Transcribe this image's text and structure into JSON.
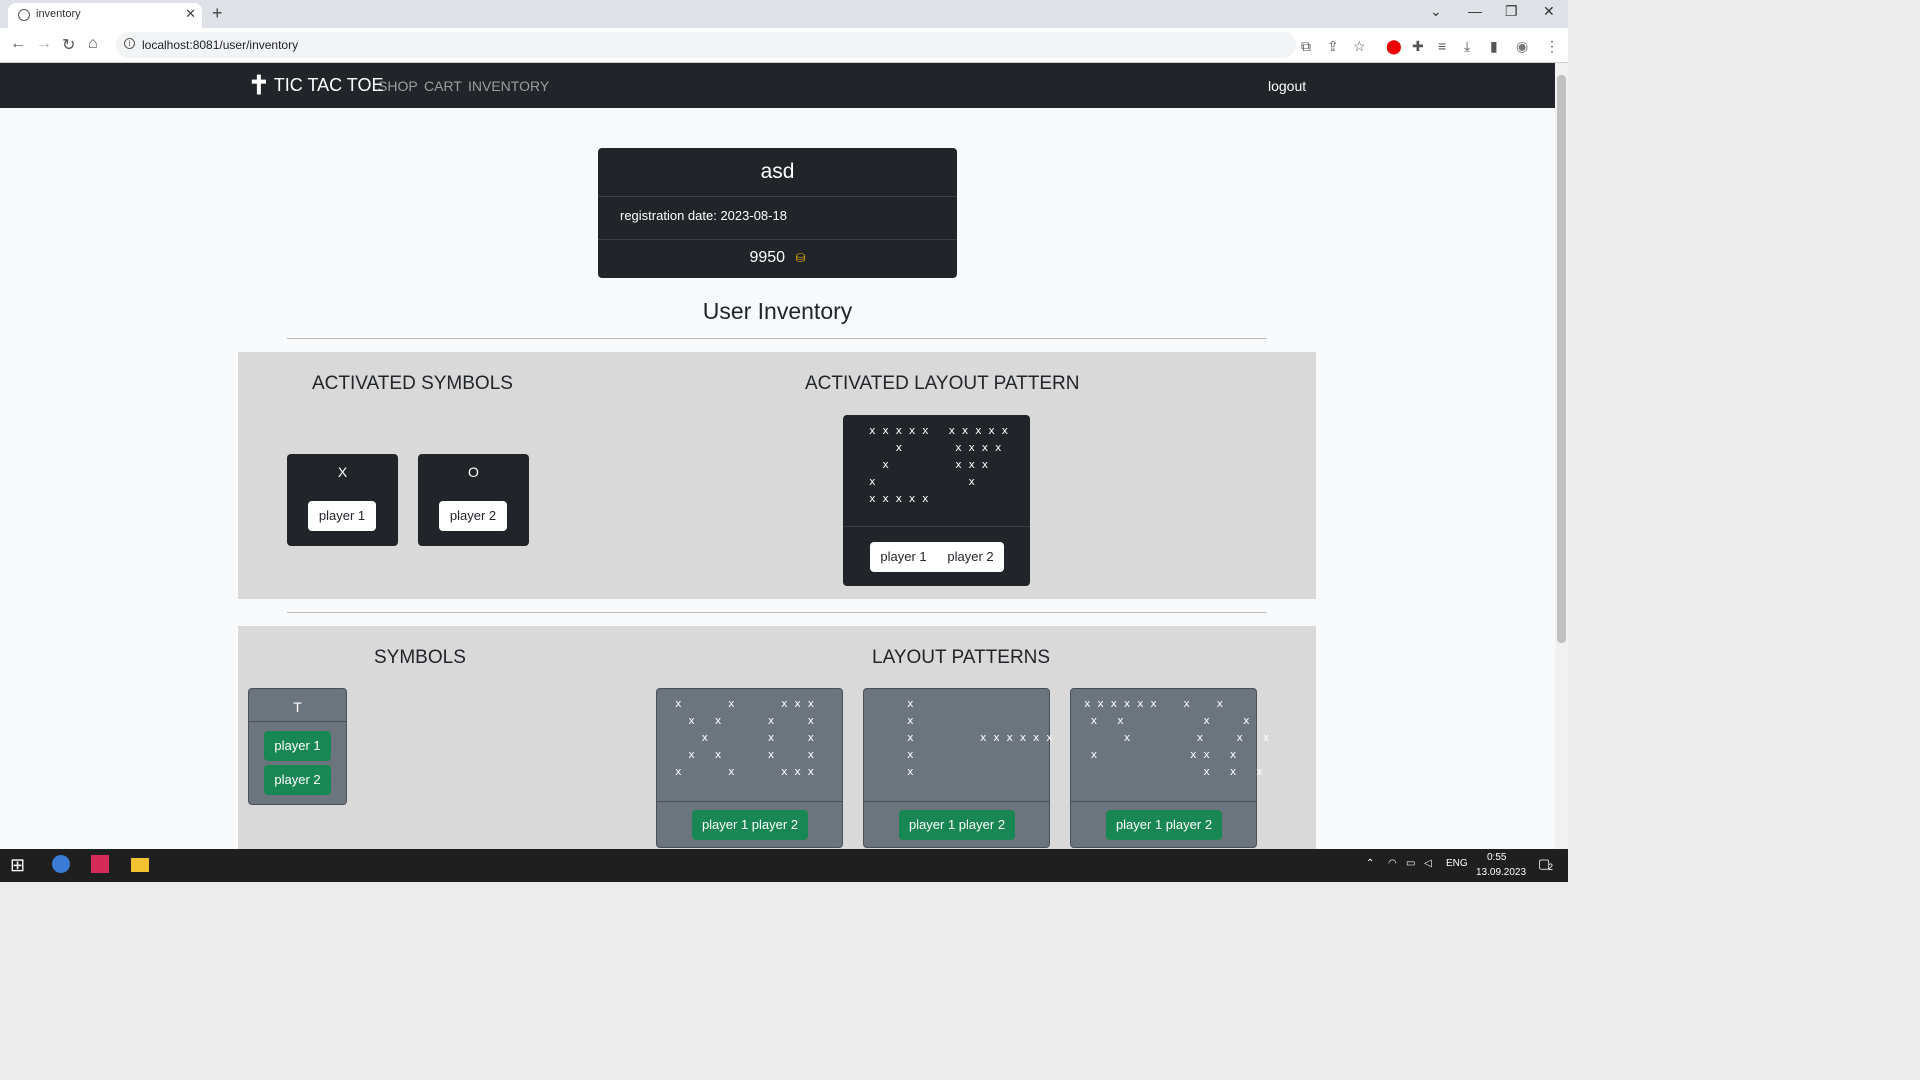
{
  "browser": {
    "tab_title": "inventory",
    "tab_close": "✕",
    "new_tab": "+",
    "url": "localhost:8081/user/inventory",
    "window_controls": [
      "⌄",
      "—",
      "❐",
      "✕"
    ]
  },
  "nav": {
    "brand": "TIC TAC TOE",
    "brand_icon": "✝",
    "links": [
      "SHOP",
      "CART",
      "INVENTORY"
    ],
    "logout": "logout"
  },
  "user": {
    "name": "asd",
    "registration": "registration date: 2023-08-18",
    "balance": "9950",
    "coin_icon": "coins-icon"
  },
  "inventory_title": "User Inventory",
  "activated": {
    "symbols_heading": "ACTIVATED SYMBOLS",
    "layout_heading": "ACTIVATED LAYOUT PATTERN",
    "symbols": [
      {
        "char": "X",
        "player": "player 1"
      },
      {
        "char": "O",
        "player": "player 2"
      }
    ],
    "layout": {
      "grid": "x x x x x   x x x x x\n    x        x x x x\n  x          x x x\nx              x\nx x x x x",
      "player1": "player 1",
      "player2": "player 2"
    }
  },
  "owned": {
    "symbols_heading": "SYMBOLS",
    "layout_heading": "LAYOUT PATTERNS",
    "symbols": [
      {
        "char": "T",
        "player1": "player 1",
        "player2": "player 2"
      }
    ],
    "patterns": [
      {
        "grid": "x       x       x x x\n  x   x       x     x\n    x         x     x\n  x   x       x     x\nx       x       x x x",
        "buttons": "player 1 player 2"
      },
      {
        "grid": "x\nx\nx          x x x x x x\nx\nx",
        "buttons": "player 1 player 2"
      },
      {
        "grid": "x x x x x x    x    x\n x   x            x     x\n      x          x     x   x\n x              x x   x\n                  x   x   x",
        "buttons": "player 1 player 2"
      }
    ]
  },
  "taskbar": {
    "lang": "ENG",
    "time": "0:55",
    "date": "13.09.2023",
    "notifications": "2"
  }
}
